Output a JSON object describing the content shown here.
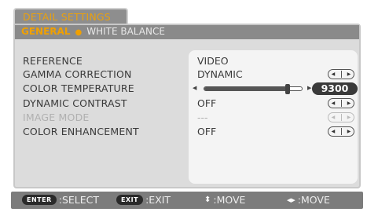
{
  "menu": {
    "title": "DETAIL SETTINGS",
    "tabs": [
      {
        "label": "GENERAL",
        "active": true
      },
      {
        "label": "WHITE BALANCE",
        "active": false
      }
    ],
    "tab_separator": "●"
  },
  "rows": {
    "reference": {
      "label": "REFERENCE",
      "value": "VIDEO"
    },
    "gamma": {
      "label": "GAMMA CORRECTION",
      "value": "DYNAMIC"
    },
    "color_temp": {
      "label": "COLOR TEMPERATURE",
      "value": "9300",
      "slider_fraction": 0.85
    },
    "dynamic_contrast": {
      "label": "DYNAMIC CONTRAST",
      "value": "OFF"
    },
    "image_mode": {
      "label": "IMAGE MODE",
      "value": "---",
      "disabled": true
    },
    "color_enhancement": {
      "label": "COLOR ENHANCEMENT",
      "value": "OFF"
    }
  },
  "arrows": {
    "left": "◀",
    "right": "▶"
  },
  "footer": {
    "enter_key": "ENTER",
    "enter_label": ":SELECT",
    "exit_key": "EXIT",
    "exit_label": ":EXIT",
    "updown_glyph": "⬍",
    "updown_label": ":MOVE",
    "leftright_glyph": "◀▶",
    "leftright_label": ":MOVE"
  },
  "colors": {
    "accent": "#f0a000",
    "panel": "#dcdcdc",
    "header": "#8a8a8a",
    "value_pill": "#3a3a3a"
  }
}
